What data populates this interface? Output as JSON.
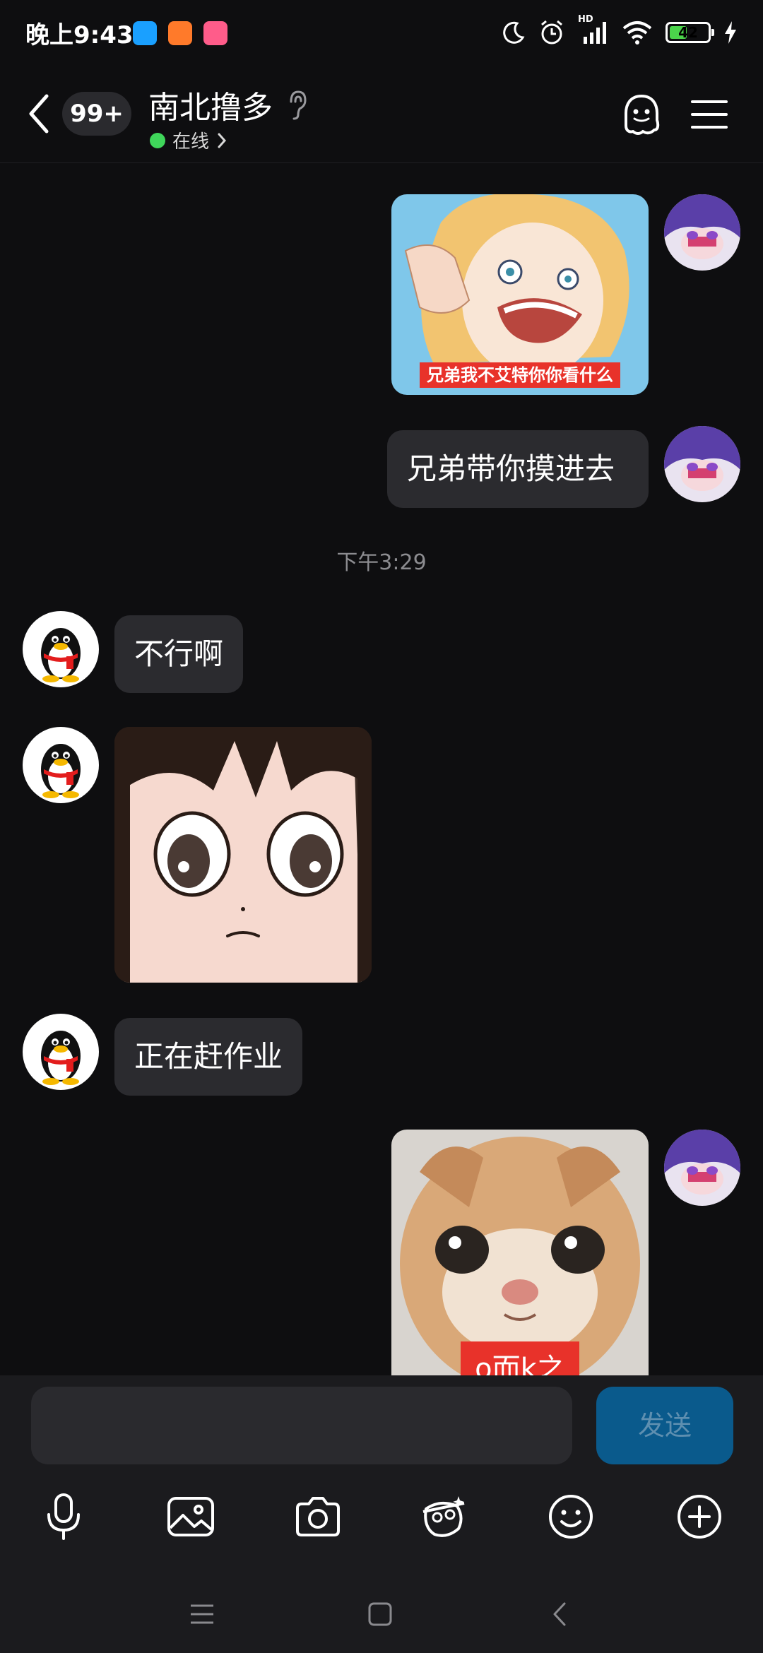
{
  "status_bar": {
    "time": "晚上9:43",
    "battery_level": "42",
    "network_badge": "HD"
  },
  "header": {
    "unread_count": "99+",
    "contact_name": "南北撸多",
    "online_status": "在线"
  },
  "messages": [
    {
      "side": "right",
      "type": "image",
      "caption": "兄弟我不艾特你你看什么"
    },
    {
      "side": "right",
      "type": "text",
      "text": "兄弟带你摸进去"
    },
    {
      "type": "time",
      "text": "下午3:29"
    },
    {
      "side": "left",
      "type": "text",
      "text": "不行啊"
    },
    {
      "side": "left",
      "type": "image"
    },
    {
      "side": "left",
      "type": "text",
      "text": "正在赶作业"
    },
    {
      "side": "right",
      "type": "image",
      "caption": "o而k之"
    }
  ],
  "input": {
    "placeholder": "",
    "send_label": "发送"
  },
  "icons": {
    "toolbar": [
      "microphone-icon",
      "image-icon",
      "camera-icon",
      "sticker-icon",
      "emoji-icon",
      "plus-icon"
    ],
    "nav": [
      "menu-icon",
      "home-icon",
      "back-icon"
    ]
  },
  "colors": {
    "background": "#0e0e10",
    "bubble": "#2b2b2f",
    "send_button": "#0a5a8c",
    "online": "#3fd65a",
    "caption_bg": "#e8322a"
  }
}
